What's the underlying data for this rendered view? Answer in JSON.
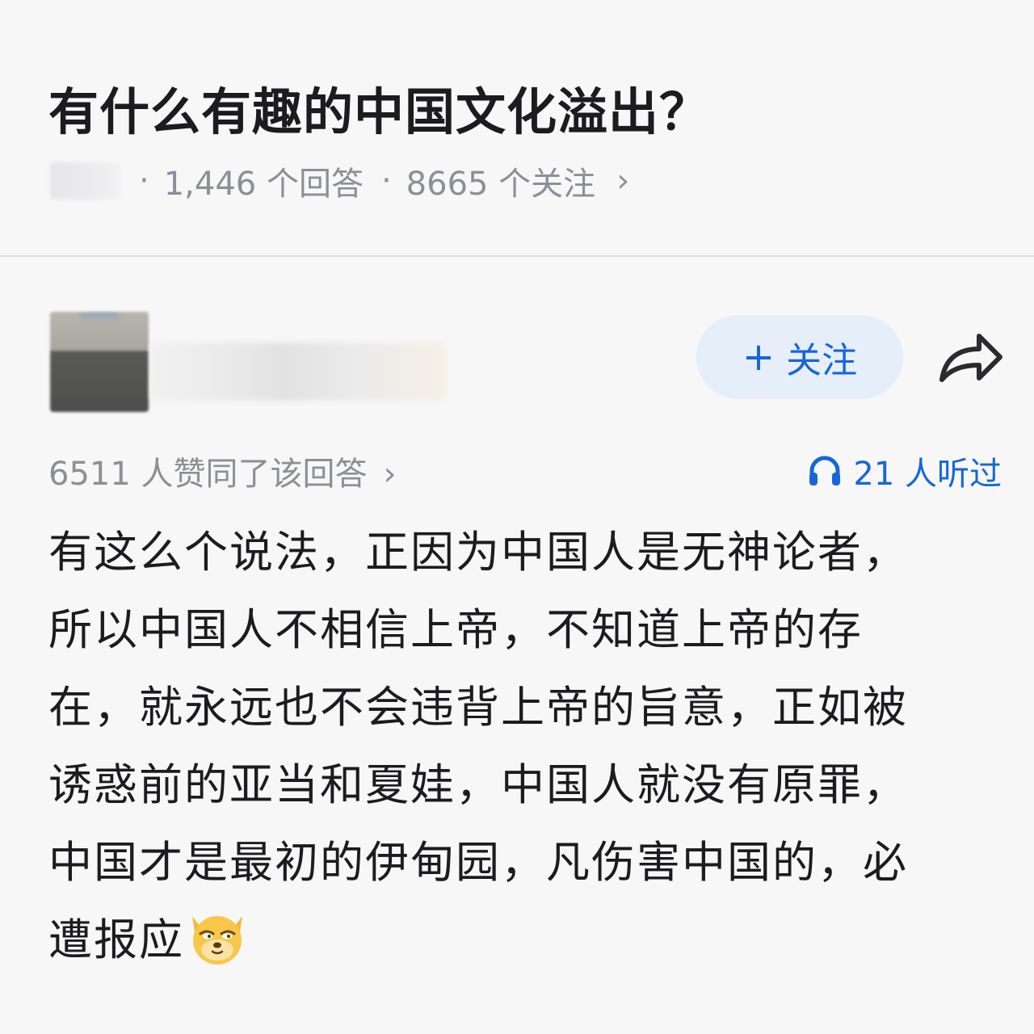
{
  "question": {
    "title": "有什么有趣的中国文化溢出？",
    "answers_count": "1,446 个回答",
    "followers_count": "8665 个关注",
    "separator": "·",
    "chevron": "›"
  },
  "author": {
    "follow_plus": "+",
    "follow_label": "关注",
    "share_icon": "share-arrow"
  },
  "stats": {
    "votes_text": "6511 人赞同了该回答",
    "votes_chevron": "›",
    "listens_text": "21 人听过",
    "listens_icon": "headphones"
  },
  "answer": {
    "lines": [
      "有这么个说法，正因为中国人是无神论者，",
      "所以中国人不相信上帝，不知道上帝的存",
      "在，就永远也不会违背上帝的旨意，正如被",
      "诱惑前的亚当和夏娃，中国人就没有原罪，",
      "中国才是最初的伊甸园，凡伤害中国的，必",
      "遭报应"
    ],
    "emoji": "doge"
  },
  "colors": {
    "accent": "#1766d8",
    "follow_bg": "#e6eef9",
    "meta_text": "#8d8f96",
    "body_text": "#1c1c1e",
    "background": "#f7f7f8"
  }
}
